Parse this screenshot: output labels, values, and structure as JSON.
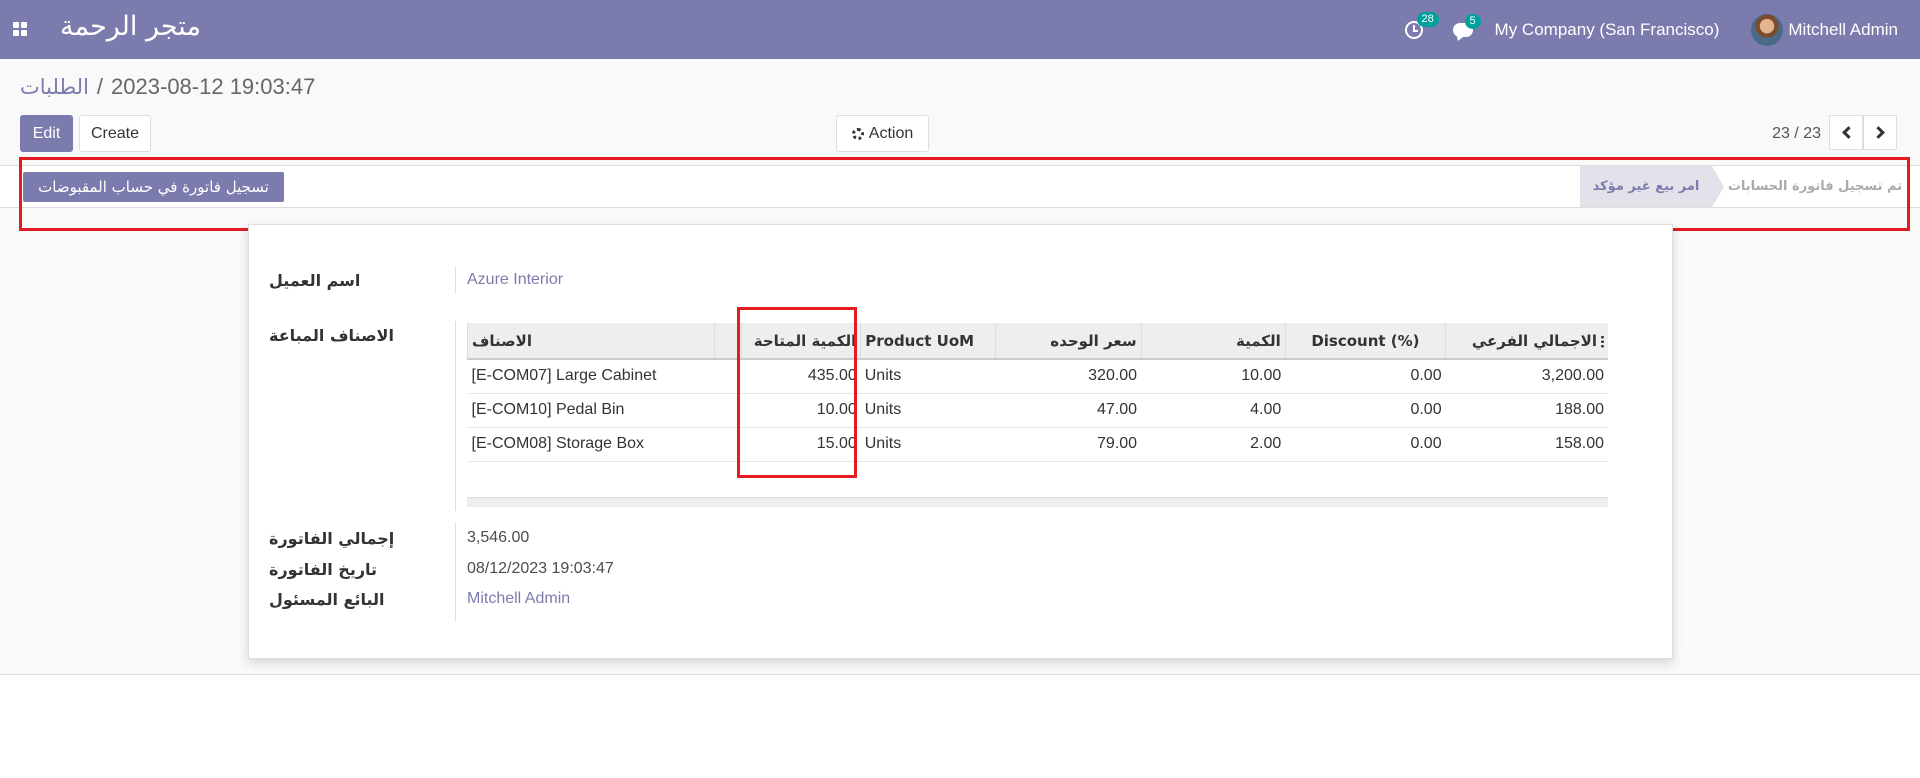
{
  "navbar": {
    "brand": "متجر الرحمة",
    "activity_count": "28",
    "messages_count": "5",
    "company": "My Company (San Francisco)",
    "user": "Mitchell Admin",
    "bg_color": "#7c7bad"
  },
  "breadcrumb": {
    "parent": "الطلبات",
    "separator": "/",
    "current": "2023-08-12 19:03:47"
  },
  "control_panel": {
    "edit_label": "Edit",
    "create_label": "Create",
    "action_label": "Action",
    "pager": "23 / 23"
  },
  "statusbar": {
    "register_button": "تسجيل فاتورة في حساب المقبوضات",
    "stages": [
      {
        "label": "امر بيع غير مؤكد",
        "current": true
      },
      {
        "label": "تم تسجيل فاتورة الحسابات",
        "current": false
      }
    ]
  },
  "form": {
    "customer_label": "اسم العميل",
    "customer_value": "Azure Interior",
    "lines_label": "الاصناف المباعة",
    "total_label": "إجمالي الفاتورة",
    "total_value": "3,546.00",
    "date_label": "تاريخ الفاتورة",
    "date_value": "08/12/2023 19:03:47",
    "salesperson_label": "البائع المسئول",
    "salesperson_value": "Mitchell Admin"
  },
  "lines_table": {
    "headers": {
      "product": "الاصناف",
      "available_qty": "الكمية المتاحة",
      "uom": "Product UoM",
      "unit_price": "سعر الوحده",
      "qty": "الكمية",
      "discount": "Discount (%)",
      "subtotal": "الاجمالي الفرعي"
    },
    "rows": [
      {
        "product": "[E-COM07] Large Cabinet",
        "available_qty": "435.00",
        "uom": "Units",
        "unit_price": "320.00",
        "qty": "10.00",
        "discount": "0.00",
        "subtotal": "3,200.00"
      },
      {
        "product": "[E-COM10] Pedal Bin",
        "available_qty": "10.00",
        "uom": "Units",
        "unit_price": "47.00",
        "qty": "4.00",
        "discount": "0.00",
        "subtotal": "188.00"
      },
      {
        "product": "[E-COM08] Storage Box",
        "available_qty": "15.00",
        "uom": "Units",
        "unit_price": "79.00",
        "qty": "2.00",
        "discount": "0.00",
        "subtotal": "158.00"
      }
    ]
  },
  "highlight_color": "#e31b23"
}
